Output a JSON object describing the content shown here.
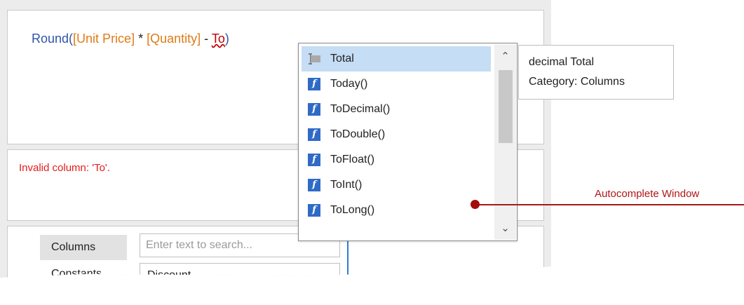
{
  "expression": {
    "fn": "Round(",
    "col1": "[Unit Price]",
    "op1": " * ",
    "col2": "[Quantity]",
    "op2": " - ",
    "err_token": "To",
    "close": ")"
  },
  "error_message": "Invalid column: 'To'.",
  "categories": [
    {
      "label": "Columns",
      "selected": true
    },
    {
      "label": "Constants",
      "selected": false
    }
  ],
  "search": {
    "placeholder": "Enter text to search..."
  },
  "field_list": [
    {
      "label": "Discount"
    }
  ],
  "autocomplete": {
    "items": [
      {
        "label": "Total",
        "icon": "column-icon",
        "selected": true
      },
      {
        "label": "Today()",
        "icon": "function-icon",
        "selected": false
      },
      {
        "label": "ToDecimal()",
        "icon": "function-icon",
        "selected": false
      },
      {
        "label": "ToDouble()",
        "icon": "function-icon",
        "selected": false
      },
      {
        "label": "ToFloat()",
        "icon": "function-icon",
        "selected": false
      },
      {
        "label": "ToInt()",
        "icon": "function-icon",
        "selected": false
      },
      {
        "label": "ToLong()",
        "icon": "function-icon",
        "selected": false
      }
    ],
    "function_icon_glyph": "f",
    "scroll_up_glyph": "⌃",
    "scroll_down_glyph": "⌄"
  },
  "tooltip": {
    "line1": "decimal Total",
    "line2": "Category: Columns"
  },
  "callout": {
    "label": "Autocomplete Window"
  },
  "colors": {
    "function_token": "#2f54a8",
    "column_token": "#e07b16",
    "error": "#e31c1c",
    "selection": "#c5ddf5",
    "callout": "#a31b1b"
  }
}
